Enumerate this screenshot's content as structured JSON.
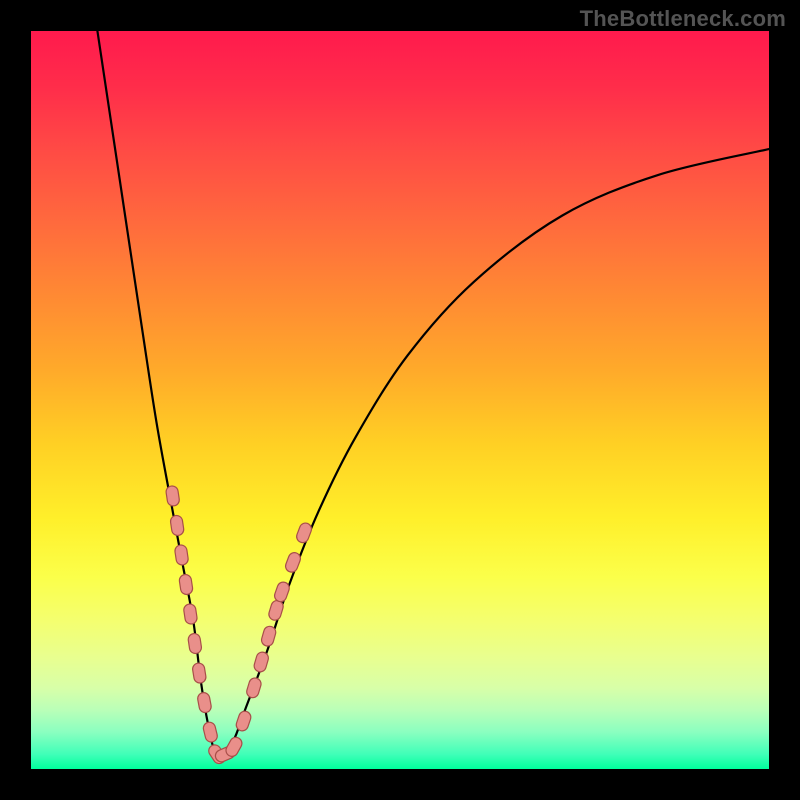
{
  "watermark_text": "TheBottleneck.com",
  "chart_data": {
    "type": "line",
    "title": "",
    "xlabel": "",
    "ylabel": "",
    "xlim": [
      0,
      100
    ],
    "ylim": [
      0,
      100
    ],
    "series": [
      {
        "name": "bottleneck-curve",
        "x": [
          9,
          12,
          15,
          17,
          19,
          20.5,
          22,
          23,
          24,
          25,
          26,
          27.5,
          29,
          32,
          35,
          39,
          44,
          51,
          60,
          72,
          85,
          100
        ],
        "y": [
          100,
          80,
          60,
          47,
          36,
          28,
          20,
          12,
          6,
          2,
          2,
          4,
          8,
          16,
          25,
          35,
          45,
          56,
          66,
          75,
          80.5,
          84
        ]
      }
    ],
    "beads": {
      "name": "cluster-markers",
      "points": [
        {
          "x": 19.2,
          "y": 37
        },
        {
          "x": 19.8,
          "y": 33
        },
        {
          "x": 20.4,
          "y": 29
        },
        {
          "x": 21.0,
          "y": 25
        },
        {
          "x": 21.6,
          "y": 21
        },
        {
          "x": 22.2,
          "y": 17
        },
        {
          "x": 22.8,
          "y": 13
        },
        {
          "x": 23.5,
          "y": 9
        },
        {
          "x": 24.3,
          "y": 5
        },
        {
          "x": 25.2,
          "y": 2
        },
        {
          "x": 26.3,
          "y": 2
        },
        {
          "x": 27.5,
          "y": 3
        },
        {
          "x": 28.8,
          "y": 6.5
        },
        {
          "x": 30.2,
          "y": 11
        },
        {
          "x": 31.2,
          "y": 14.5
        },
        {
          "x": 32.2,
          "y": 18
        },
        {
          "x": 33.2,
          "y": 21.5
        },
        {
          "x": 34.0,
          "y": 24
        },
        {
          "x": 35.5,
          "y": 28
        },
        {
          "x": 37.0,
          "y": 32
        }
      ]
    },
    "gradient_stops": [
      {
        "pos": 0,
        "color": "#ff1a4d"
      },
      {
        "pos": 100,
        "color": "#00ff9c"
      }
    ]
  }
}
